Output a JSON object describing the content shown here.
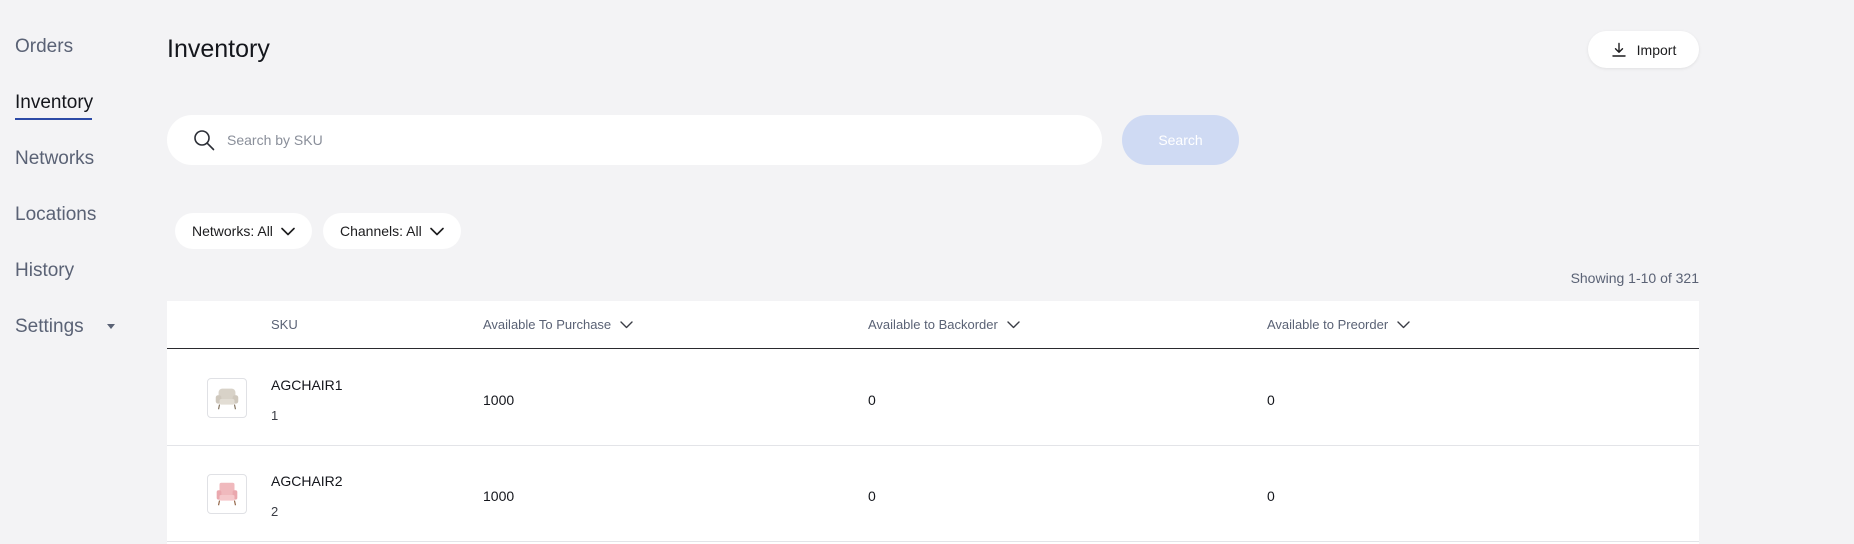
{
  "sidebar": {
    "items": [
      {
        "label": "Orders"
      },
      {
        "label": "Inventory"
      },
      {
        "label": "Networks"
      },
      {
        "label": "Locations"
      },
      {
        "label": "History"
      },
      {
        "label": "Settings"
      }
    ],
    "active": "Inventory"
  },
  "header": {
    "title": "Inventory",
    "import_label": "Import"
  },
  "search": {
    "placeholder": "Search by SKU",
    "value": "",
    "button_label": "Search"
  },
  "filters": [
    {
      "label": "Networks: All"
    },
    {
      "label": "Channels: All"
    }
  ],
  "pagination": {
    "showing": "Showing 1-10 of 321"
  },
  "table": {
    "columns": [
      "SKU",
      "Available To Purchase",
      "Available to Backorder",
      "Available to Preorder"
    ],
    "rows": [
      {
        "sku": "AGCHAIR1",
        "sub": "1",
        "purchase": "1000",
        "backorder": "0",
        "preorder": "0",
        "thumb_color": "#d8d2c8"
      },
      {
        "sku": "AGCHAIR2",
        "sub": "2",
        "purchase": "1000",
        "backorder": "0",
        "preorder": "0",
        "thumb_color": "#f0b9bd"
      }
    ]
  },
  "colors": {
    "accent": "#2c4aa6",
    "search_button_disabled": "#cfdaf3",
    "background": "#f3f3f5"
  }
}
